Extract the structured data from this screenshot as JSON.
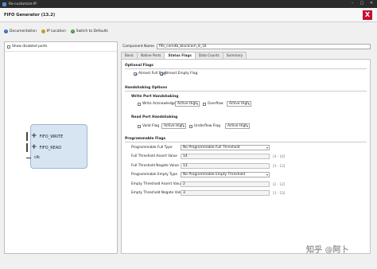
{
  "window": {
    "title": "Re-customize IP"
  },
  "header": {
    "title": "FIFO Generator (13.2)"
  },
  "toolbar": {
    "documentation": "Documentation",
    "ip_location": "IP Location",
    "switch_defaults": "Switch to Defaults"
  },
  "left_panel": {
    "show_disabled_ports": "Show disabled ports",
    "ports": [
      {
        "name": "FIFO_WRITE"
      },
      {
        "name": "FIFO_READ"
      },
      {
        "name": "clk"
      }
    ]
  },
  "component": {
    "label": "Component Name",
    "value": "fifo_comdb_blockram_8_16"
  },
  "tabs": [
    {
      "label": "Basic",
      "active": false
    },
    {
      "label": "Native Ports",
      "active": false
    },
    {
      "label": "Status Flags",
      "active": true
    },
    {
      "label": "Data Counts",
      "active": false
    },
    {
      "label": "Summary",
      "active": false
    }
  ],
  "optional_flags": {
    "title": "Optional Flags",
    "almost_full": {
      "label": "Almost Full Flag",
      "checked": true
    },
    "almost_empty": {
      "label": "Almost Empty Flag",
      "checked": true
    }
  },
  "handshaking": {
    "title": "Handshaking Options",
    "write": {
      "title": "Write Port Handshaking",
      "ack_label": "Write Acknowledge",
      "ack_select": "Active High",
      "overflow_label": "Overflow",
      "overflow_select": "Active High"
    },
    "read": {
      "title": "Read Port Handshaking",
      "valid_label": "Valid Flag",
      "valid_select": "Active High",
      "underflow_label": "Underflow Flag",
      "underflow_select": "Active High"
    }
  },
  "programmable": {
    "title": "Programmable Flags",
    "full_type_label": "Programmable Full Type",
    "full_type_value": "No Programmable Full Threshold",
    "full_assert_label": "Full Threshold Assert Value",
    "full_assert_value": "14",
    "full_assert_range": "[4 - 14]",
    "full_negate_label": "Full Threshold Negate Value",
    "full_negate_value": "13",
    "full_negate_range": "[3 - 13]",
    "empty_type_label": "Programmable Empty Type",
    "empty_type_value": "No Programmable Empty Threshold",
    "empty_assert_label": "Empty Threshold Assert Value",
    "empty_assert_value": "2",
    "empty_assert_range": "[2 - 12]",
    "empty_negate_label": "Empty Threshold Negate Value",
    "empty_negate_value": "3",
    "empty_negate_range": "[3 - 13]"
  },
  "watermark": "知乎 @阿卜",
  "colors": {
    "accent": "#2f6bbd",
    "ip_block": "#d7e5f3",
    "titlebar": "#2b2b2b"
  }
}
